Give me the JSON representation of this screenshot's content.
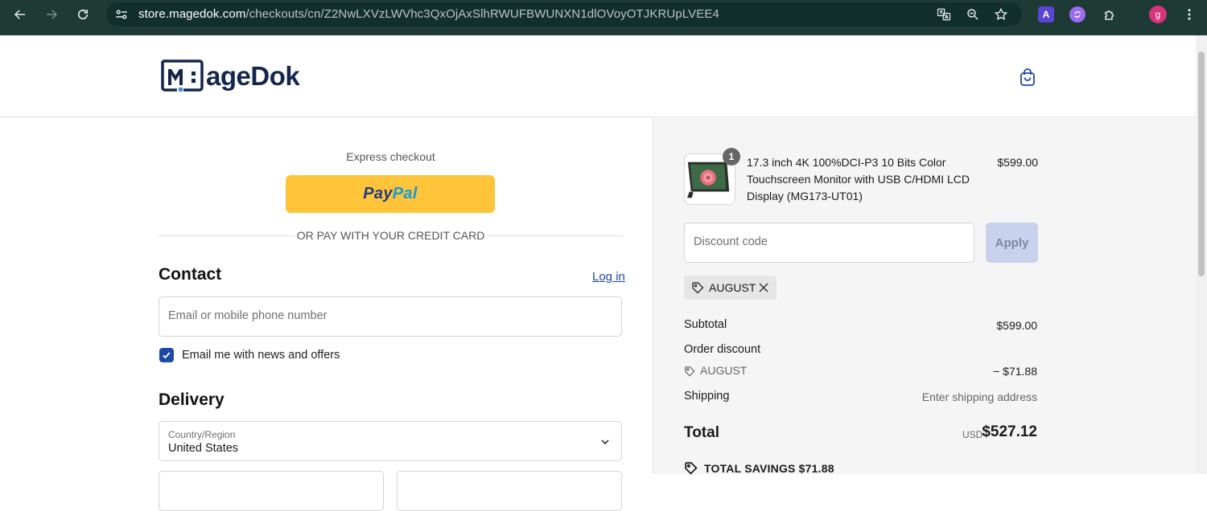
{
  "browser": {
    "url_host": "store.magedok.com",
    "url_path": "/checkouts/cn/Z2NwLXVzLWVhc3QxOjAxSlhRWUFBWUNXN1dlOVoyOTJKRUpLVEE4",
    "profile_initial": "g",
    "extension_letter": "A"
  },
  "header": {
    "logo_text": "ageDok"
  },
  "checkout": {
    "express_label": "Express checkout",
    "paypal_part1": "Pay",
    "paypal_part2": "Pal",
    "divider_text": "OR PAY WITH YOUR CREDIT CARD",
    "contact_title": "Contact",
    "login_link": "Log in",
    "email_placeholder": "Email or mobile phone number",
    "newsletter_label": "Email me with news and offers",
    "newsletter_checked": true,
    "delivery_title": "Delivery",
    "country_label": "Country/Region",
    "country_value": "United States"
  },
  "summary": {
    "item": {
      "quantity": "1",
      "name": "17.3 inch 4K 100%DCI-P3 10 Bits Color Touchscreen Monitor with USB C/HDMI LCD Display (MG173-UT01)",
      "price": "$599.00"
    },
    "discount_placeholder": "Discount code",
    "apply_label": "Apply",
    "applied_code": "AUGUST",
    "subtotal_label": "Subtotal",
    "subtotal_value": "$599.00",
    "order_discount_label": "Order discount",
    "discount_code": "AUGUST",
    "discount_value": "− $71.88",
    "shipping_label": "Shipping",
    "shipping_value": "Enter shipping address",
    "total_label": "Total",
    "total_currency": "USD",
    "total_value": "$527.12",
    "savings_text": "TOTAL SAVINGS  $71.88"
  },
  "colors": {
    "accent": "#1b49a8",
    "paypal_yellow": "#ffc439",
    "chrome_bg": "#1e3a34"
  }
}
